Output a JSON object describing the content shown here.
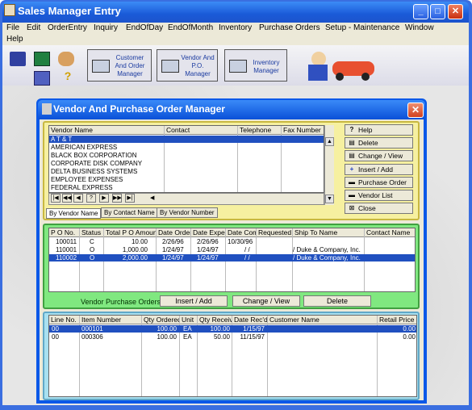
{
  "window": {
    "title": "Sales Manager Entry",
    "min": "_",
    "max": "□",
    "close": "✕"
  },
  "menu": [
    "File",
    "Edit",
    "OrderEntry",
    "Inquiry",
    "EndOfDay",
    "EndOfMonth",
    "Inventory",
    "Purchase Orders",
    "Setup - Maintenance",
    "Window",
    "Help"
  ],
  "toolbar": {
    "icons": [
      "exit-icon",
      "calculator-icon",
      "handshake-icon",
      "calendar-icon",
      "help-icon"
    ],
    "help": "?",
    "customer": "Customer And Order Manager",
    "vendor": "Vendor And P.O. Manager",
    "inventory": "Inventory Manager"
  },
  "dialog": {
    "title": "Vendor And Purchase Order Manager",
    "close": "✕"
  },
  "vendors": {
    "headers": [
      "Vendor Name",
      "Contact",
      "Telephone",
      "Fax Number"
    ],
    "rows": [
      "A T & T",
      "AMERICAN EXPRESS",
      "BLACK BOX CORPORATION",
      "CORPORATE DISK COMPANY",
      "DELTA BUSINESS SYSTEMS",
      "EMPLOYEE EXPENSES",
      "FEDERAL EXPRESS"
    ],
    "nav": [
      "|◀",
      "◀◀",
      "◀",
      "?",
      "▶",
      "▶▶",
      "▶|"
    ],
    "tabs": [
      "By Vendor Name",
      "By Contact Name",
      "By Vendor Number"
    ]
  },
  "side_buttons": [
    {
      "label": "Help",
      "icon": "?"
    },
    {
      "label": "Delete",
      "icon": "▤"
    },
    {
      "label": "Change / View",
      "icon": "▤"
    },
    {
      "label": "Insert / Add",
      "icon": "+"
    },
    {
      "label": "Purchase Order",
      "icon": "▬"
    },
    {
      "label": "Vendor List",
      "icon": "▬"
    },
    {
      "label": "Close",
      "icon": "⊠"
    }
  ],
  "po": {
    "headers": [
      "P O No.",
      "Status",
      "Total P O Amount",
      "Date Ordered",
      "Date Expected",
      "Date Completed",
      "Requested",
      "Ship To Name",
      "Contact Name"
    ],
    "rows": [
      [
        "100011",
        "C",
        "10.00",
        "2/26/96",
        "2/26/96",
        "10/30/96",
        "",
        "",
        ""
      ],
      [
        "110001",
        "O",
        "1,000.00",
        "1/24/97",
        "1/24/97",
        "/ /",
        "",
        "/ Duke & Company, Inc.",
        ""
      ],
      [
        "110002",
        "O",
        "2,000.00",
        "1/24/97",
        "1/24/97",
        "/ /",
        "",
        "/ Duke & Company, Inc.",
        ""
      ]
    ],
    "label": "Vendor Purchase Orders -",
    "insert": "Insert / Add",
    "change": "Change / View",
    "delete": "Delete"
  },
  "lines": {
    "headers": [
      "Line No.",
      "Item Number",
      "Qty Ordered",
      "Unit",
      "Qty Received",
      "Date Rec'd",
      "Customer Name",
      "Retail Price"
    ],
    "rows": [
      [
        "00",
        "000101",
        "100.00",
        "EA",
        "100.00",
        "1/15/97",
        "",
        "0.00"
      ],
      [
        "00",
        "000306",
        "100.00",
        "EA",
        "50.00",
        "11/15/97",
        "",
        "0.00"
      ]
    ]
  }
}
